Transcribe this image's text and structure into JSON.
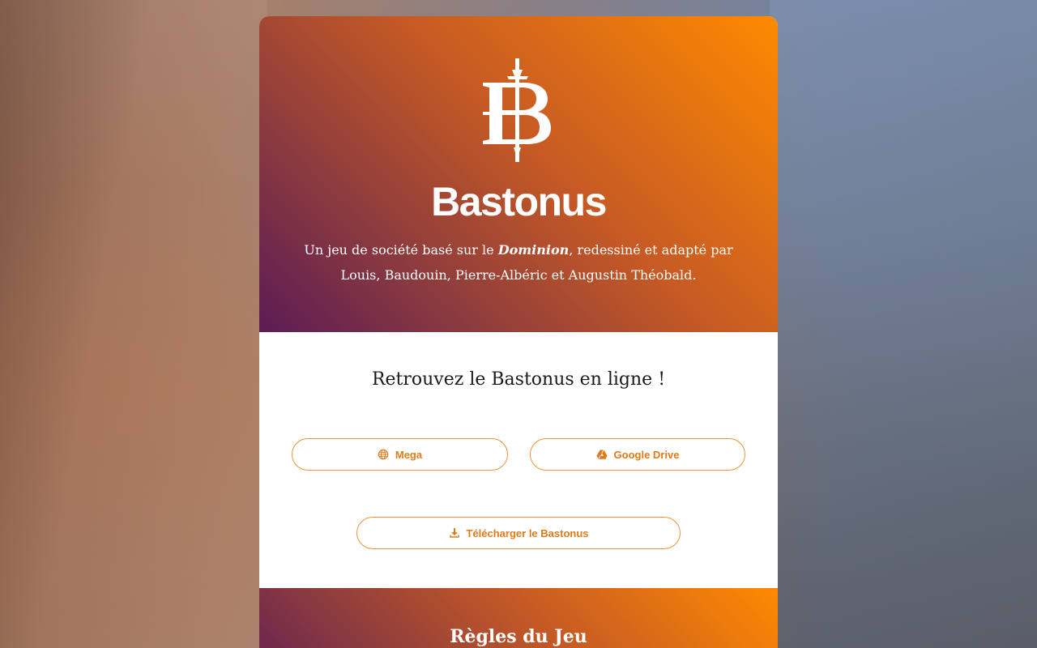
{
  "hero": {
    "title": "Bastonus",
    "subtitle_before": "Un jeu de société basé sur le ",
    "subtitle_emphasis": "Dominion",
    "subtitle_after": ", redessiné et adapté par Louis, Baudouin, Pierre-Albéric et Augustin Théobald.",
    "logo_icon": "sword-b-logo-icon"
  },
  "online": {
    "heading": "Retrouvez le Bastonus en ligne !",
    "mega_label": "Mega",
    "mega_icon": "globe-icon",
    "drive_label": "Google Drive",
    "drive_icon": "google-drive-icon",
    "download_label": "Télécharger le Bastonus",
    "download_icon": "download-icon"
  },
  "rules": {
    "heading": "Règles du Jeu"
  },
  "colors": {
    "accent": "#e07a1a",
    "gradient_start": "#ff8a00",
    "gradient_end": "#5c1b55"
  }
}
